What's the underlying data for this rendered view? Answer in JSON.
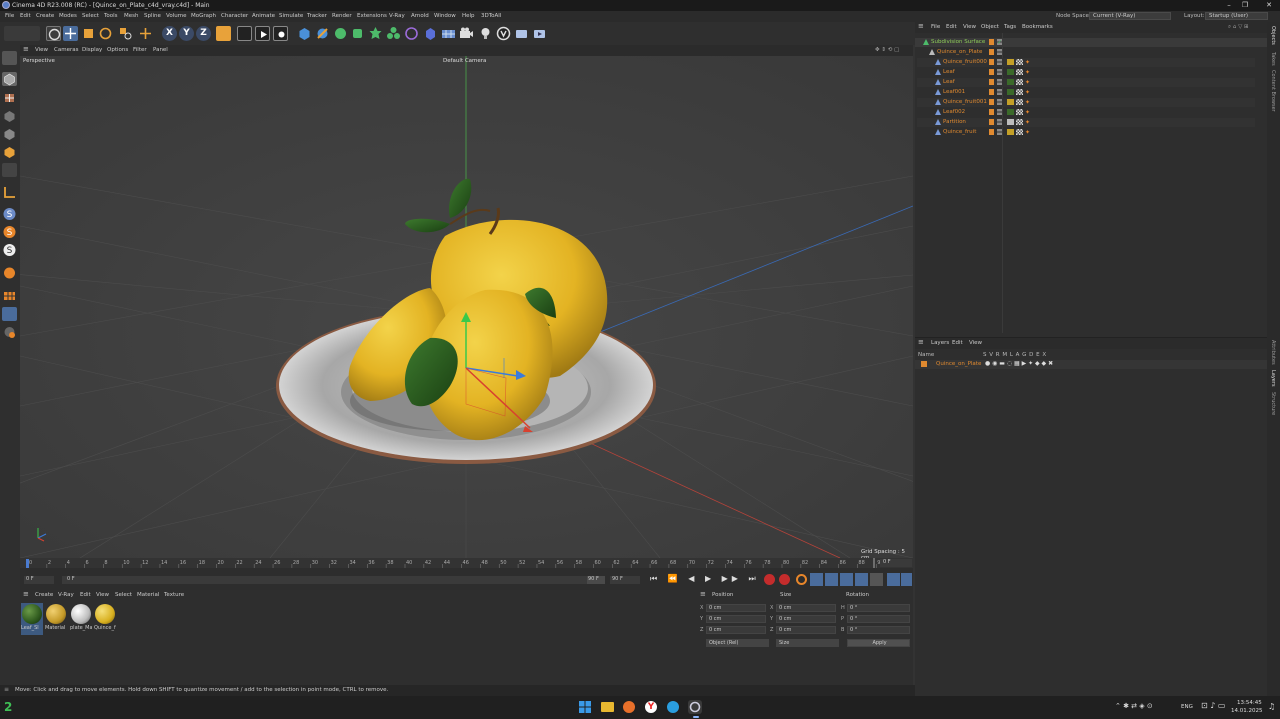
{
  "window": {
    "title": "Cinema 4D R23.008 (RC) - [Quince_on_Plate_c4d_vray.c4d] - Main",
    "min": "–",
    "max": "❐",
    "close": "✕"
  },
  "menu": [
    "File",
    "Edit",
    "Create",
    "Modes",
    "Select",
    "Tools",
    "Mesh",
    "Spline",
    "Volume",
    "MoGraph",
    "Character",
    "Animate",
    "Simulate",
    "Tracker",
    "Render",
    "Extensions",
    "V-Ray",
    "Arnold",
    "Window",
    "Help",
    "3DToAll"
  ],
  "node_space": {
    "label": "Node Space:",
    "value": "Current (V-Ray)"
  },
  "layout": {
    "label": "Layout:",
    "value": "Startup (User)"
  },
  "toolbar": {
    "x": "X",
    "y": "Y",
    "z": "Z"
  },
  "viewport": {
    "menu": [
      "View",
      "Cameras",
      "Display",
      "Options",
      "Filter",
      "Panel"
    ],
    "name": "Perspective",
    "camera": "Default Camera",
    "grid_spacing": "Grid Spacing : 5 cm"
  },
  "objects": {
    "menu": [
      "File",
      "Edit",
      "View",
      "Object",
      "Tags",
      "Bookmarks"
    ],
    "items": [
      {
        "name": "Subdivision Surface",
        "color": "#8fce5a"
      },
      {
        "name": "Quince_on_Plate",
        "color": "#e08a30"
      },
      {
        "name": "Quince_fruit000",
        "color": "#e08a30"
      },
      {
        "name": "Leaf",
        "color": "#e08a30"
      },
      {
        "name": "Leaf",
        "color": "#e08a30"
      },
      {
        "name": "Leaf001",
        "color": "#e08a30"
      },
      {
        "name": "Quince_fruit001",
        "color": "#e08a30"
      },
      {
        "name": "Leaf002",
        "color": "#e08a30"
      },
      {
        "name": "Partition",
        "color": "#e08a30"
      },
      {
        "name": "Quince_fruit",
        "color": "#e08a30"
      }
    ]
  },
  "layers": {
    "menu": [
      "Layers",
      "Edit",
      "View"
    ],
    "header_name": "Name",
    "header_cols": "S V R M L A G D E X",
    "item": "Quince_on_Plate"
  },
  "side_tabs": {
    "objects": "Objects",
    "takes": "Takes",
    "content": "Content Browser",
    "attributes": "Attributes",
    "layers": "Layers",
    "structure": "Structure"
  },
  "timeline": {
    "ticks": [
      "0",
      "2",
      "4",
      "6",
      "8",
      "10",
      "12",
      "14",
      "16",
      "18",
      "20",
      "22",
      "24",
      "26",
      "28",
      "30",
      "32",
      "34",
      "36",
      "38",
      "40",
      "42",
      "44",
      "46",
      "48",
      "50",
      "52",
      "54",
      "56",
      "58",
      "60",
      "62",
      "64",
      "66",
      "68",
      "70",
      "72",
      "74",
      "76",
      "78",
      "80",
      "82",
      "84",
      "86",
      "88",
      "90"
    ],
    "current": "0 F",
    "start": "0 F",
    "field": "0 F",
    "end": "90 F",
    "end2": "90 F"
  },
  "materials": {
    "menu": [
      "Create",
      "V-Ray",
      "Edit",
      "View",
      "Select",
      "Material",
      "Texture"
    ],
    "items": [
      {
        "label": "Leaf_Sl",
        "color": "#2f5a1e"
      },
      {
        "label": "Material",
        "color": "#c49a28"
      },
      {
        "label": "plate_Ma",
        "color": "#bdbdbd"
      },
      {
        "label": "Quince_f",
        "color": "#d8b020"
      }
    ]
  },
  "coords": {
    "position": "Position",
    "size": "Size",
    "rotation": "Rotation",
    "rows": [
      {
        "axis": "X",
        "pos": "0 cm",
        "size": "0 cm",
        "raxis": "H",
        "rot": "0 °"
      },
      {
        "axis": "Y",
        "pos": "0 cm",
        "size": "0 cm",
        "raxis": "P",
        "rot": "0 °"
      },
      {
        "axis": "Z",
        "pos": "0 cm",
        "size": "0 cm",
        "raxis": "B",
        "rot": "0 °"
      }
    ],
    "mode": "Object (Rel)",
    "size_mode": "Size",
    "apply": "Apply"
  },
  "status": "Move: Click and drag to move elements. Hold down SHIFT to quantize movement / add to the selection in point mode, CTRL to remove.",
  "taskbar": {
    "badge": "2",
    "lang": "ENG",
    "time": "13:54:45",
    "date": "14.01.2025"
  }
}
